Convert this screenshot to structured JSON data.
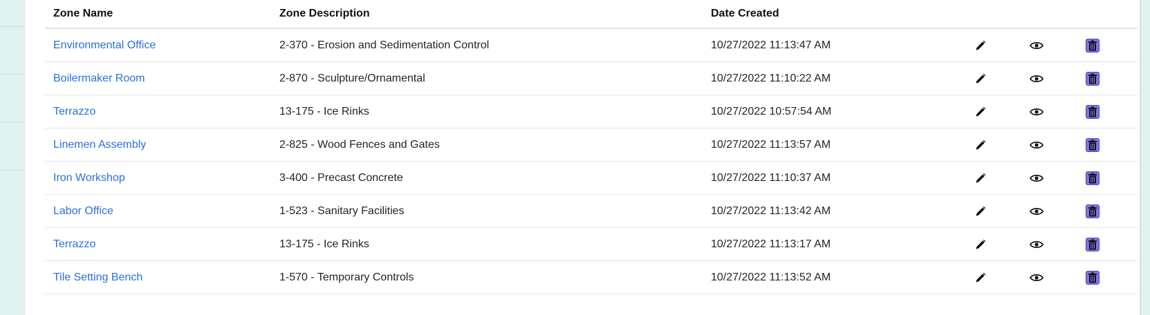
{
  "table": {
    "headers": {
      "zone_name": "Zone Name",
      "zone_description": "Zone Description",
      "date_created": "Date Created"
    },
    "rows": [
      {
        "zone_name": "Environmental Office",
        "zone_description": "2-370 - Erosion and Sedimentation Control",
        "date_created": "10/27/2022 11:13:47 AM"
      },
      {
        "zone_name": "Boilermaker Room",
        "zone_description": "2-870 - Sculpture/Ornamental",
        "date_created": "10/27/2022 11:10:22 AM"
      },
      {
        "zone_name": "Terrazzo",
        "zone_description": "13-175 - Ice Rinks",
        "date_created": "10/27/2022 10:57:54 AM"
      },
      {
        "zone_name": "Linemen Assembly",
        "zone_description": "2-825 - Wood Fences and Gates",
        "date_created": "10/27/2022 11:13:57 AM"
      },
      {
        "zone_name": "Iron Workshop",
        "zone_description": "3-400 - Precast Concrete",
        "date_created": "10/27/2022 11:10:37 AM"
      },
      {
        "zone_name": "Labor Office",
        "zone_description": "1-523 - Sanitary Facilities",
        "date_created": "10/27/2022 11:13:42 AM"
      },
      {
        "zone_name": "Terrazzo",
        "zone_description": "13-175 - Ice Rinks",
        "date_created": "10/27/2022 11:13:17 AM"
      },
      {
        "zone_name": "Tile Setting Bench",
        "zone_description": "1-570 - Temporary Controls",
        "date_created": "10/27/2022 11:13:52 AM"
      }
    ],
    "row_actions": [
      "pencil-icon",
      "eye-icon",
      "trash-icon"
    ]
  },
  "colors": {
    "link": "#2a6fdb",
    "rail": "#dff2f0",
    "delete_button": "#7b74e8"
  }
}
